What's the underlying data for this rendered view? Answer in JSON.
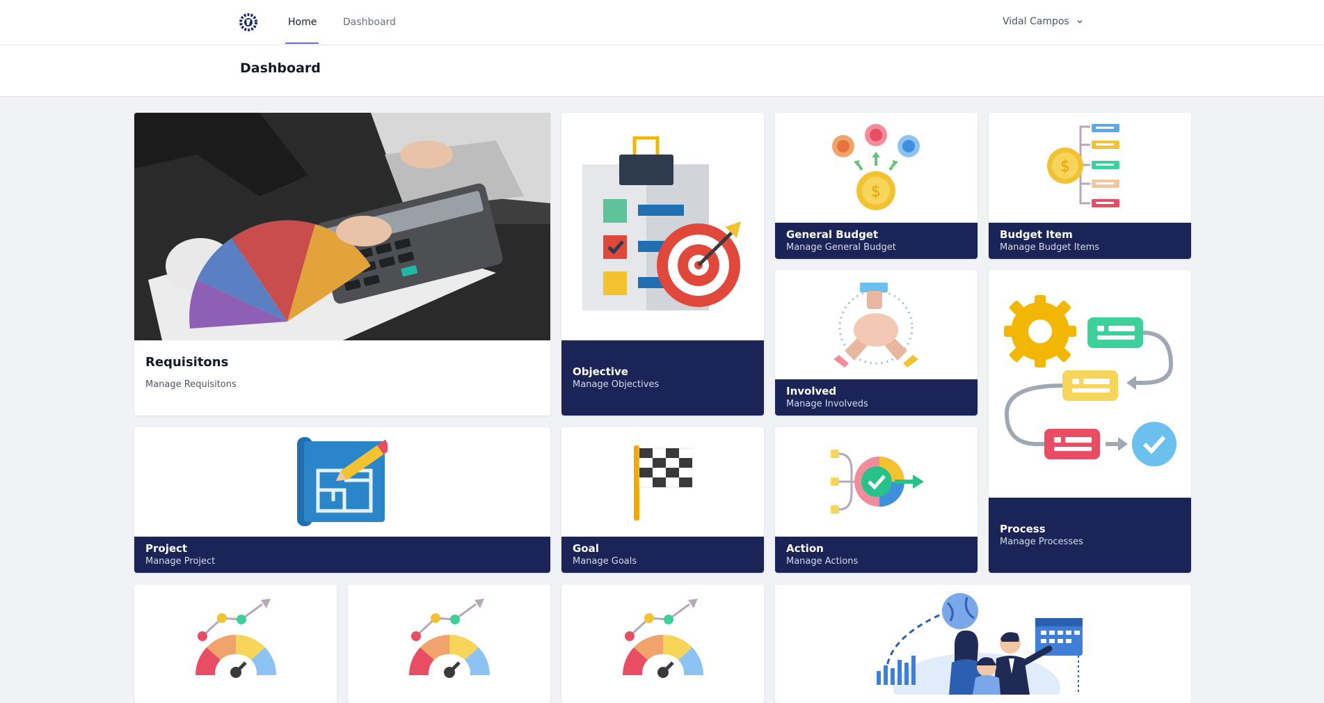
{
  "nav": {
    "home": "Home",
    "dashboard": "Dashboard",
    "user_name": "Vidal Campos"
  },
  "header": {
    "title": "Dashboard"
  },
  "cards": {
    "requisitions": {
      "title": "Requisitons",
      "subtitle": "Manage Requisitons"
    },
    "objective": {
      "title": "Objective",
      "subtitle": "Manage Objectives"
    },
    "general_budget": {
      "title": "General Budget",
      "subtitle": "Manage General Budget"
    },
    "budget_item": {
      "title": "Budget Item",
      "subtitle": "Manage Budget Items"
    },
    "involved": {
      "title": "Involved",
      "subtitle": "Manage Involveds"
    },
    "process": {
      "title": "Process",
      "subtitle": "Manage Processes"
    },
    "project": {
      "title": "Project",
      "subtitle": "Manage Project"
    },
    "goal": {
      "title": "Goal",
      "subtitle": "Manage Goals"
    },
    "action": {
      "title": "Action",
      "subtitle": "Manage Actions"
    }
  },
  "icons": {
    "logo": "gear-logo-icon",
    "chevron": "chevron-down-icon"
  },
  "colors": {
    "card_footer": "#1a2456",
    "nav_accent": "#6366f1",
    "page_bg": "#f0f2f5"
  }
}
